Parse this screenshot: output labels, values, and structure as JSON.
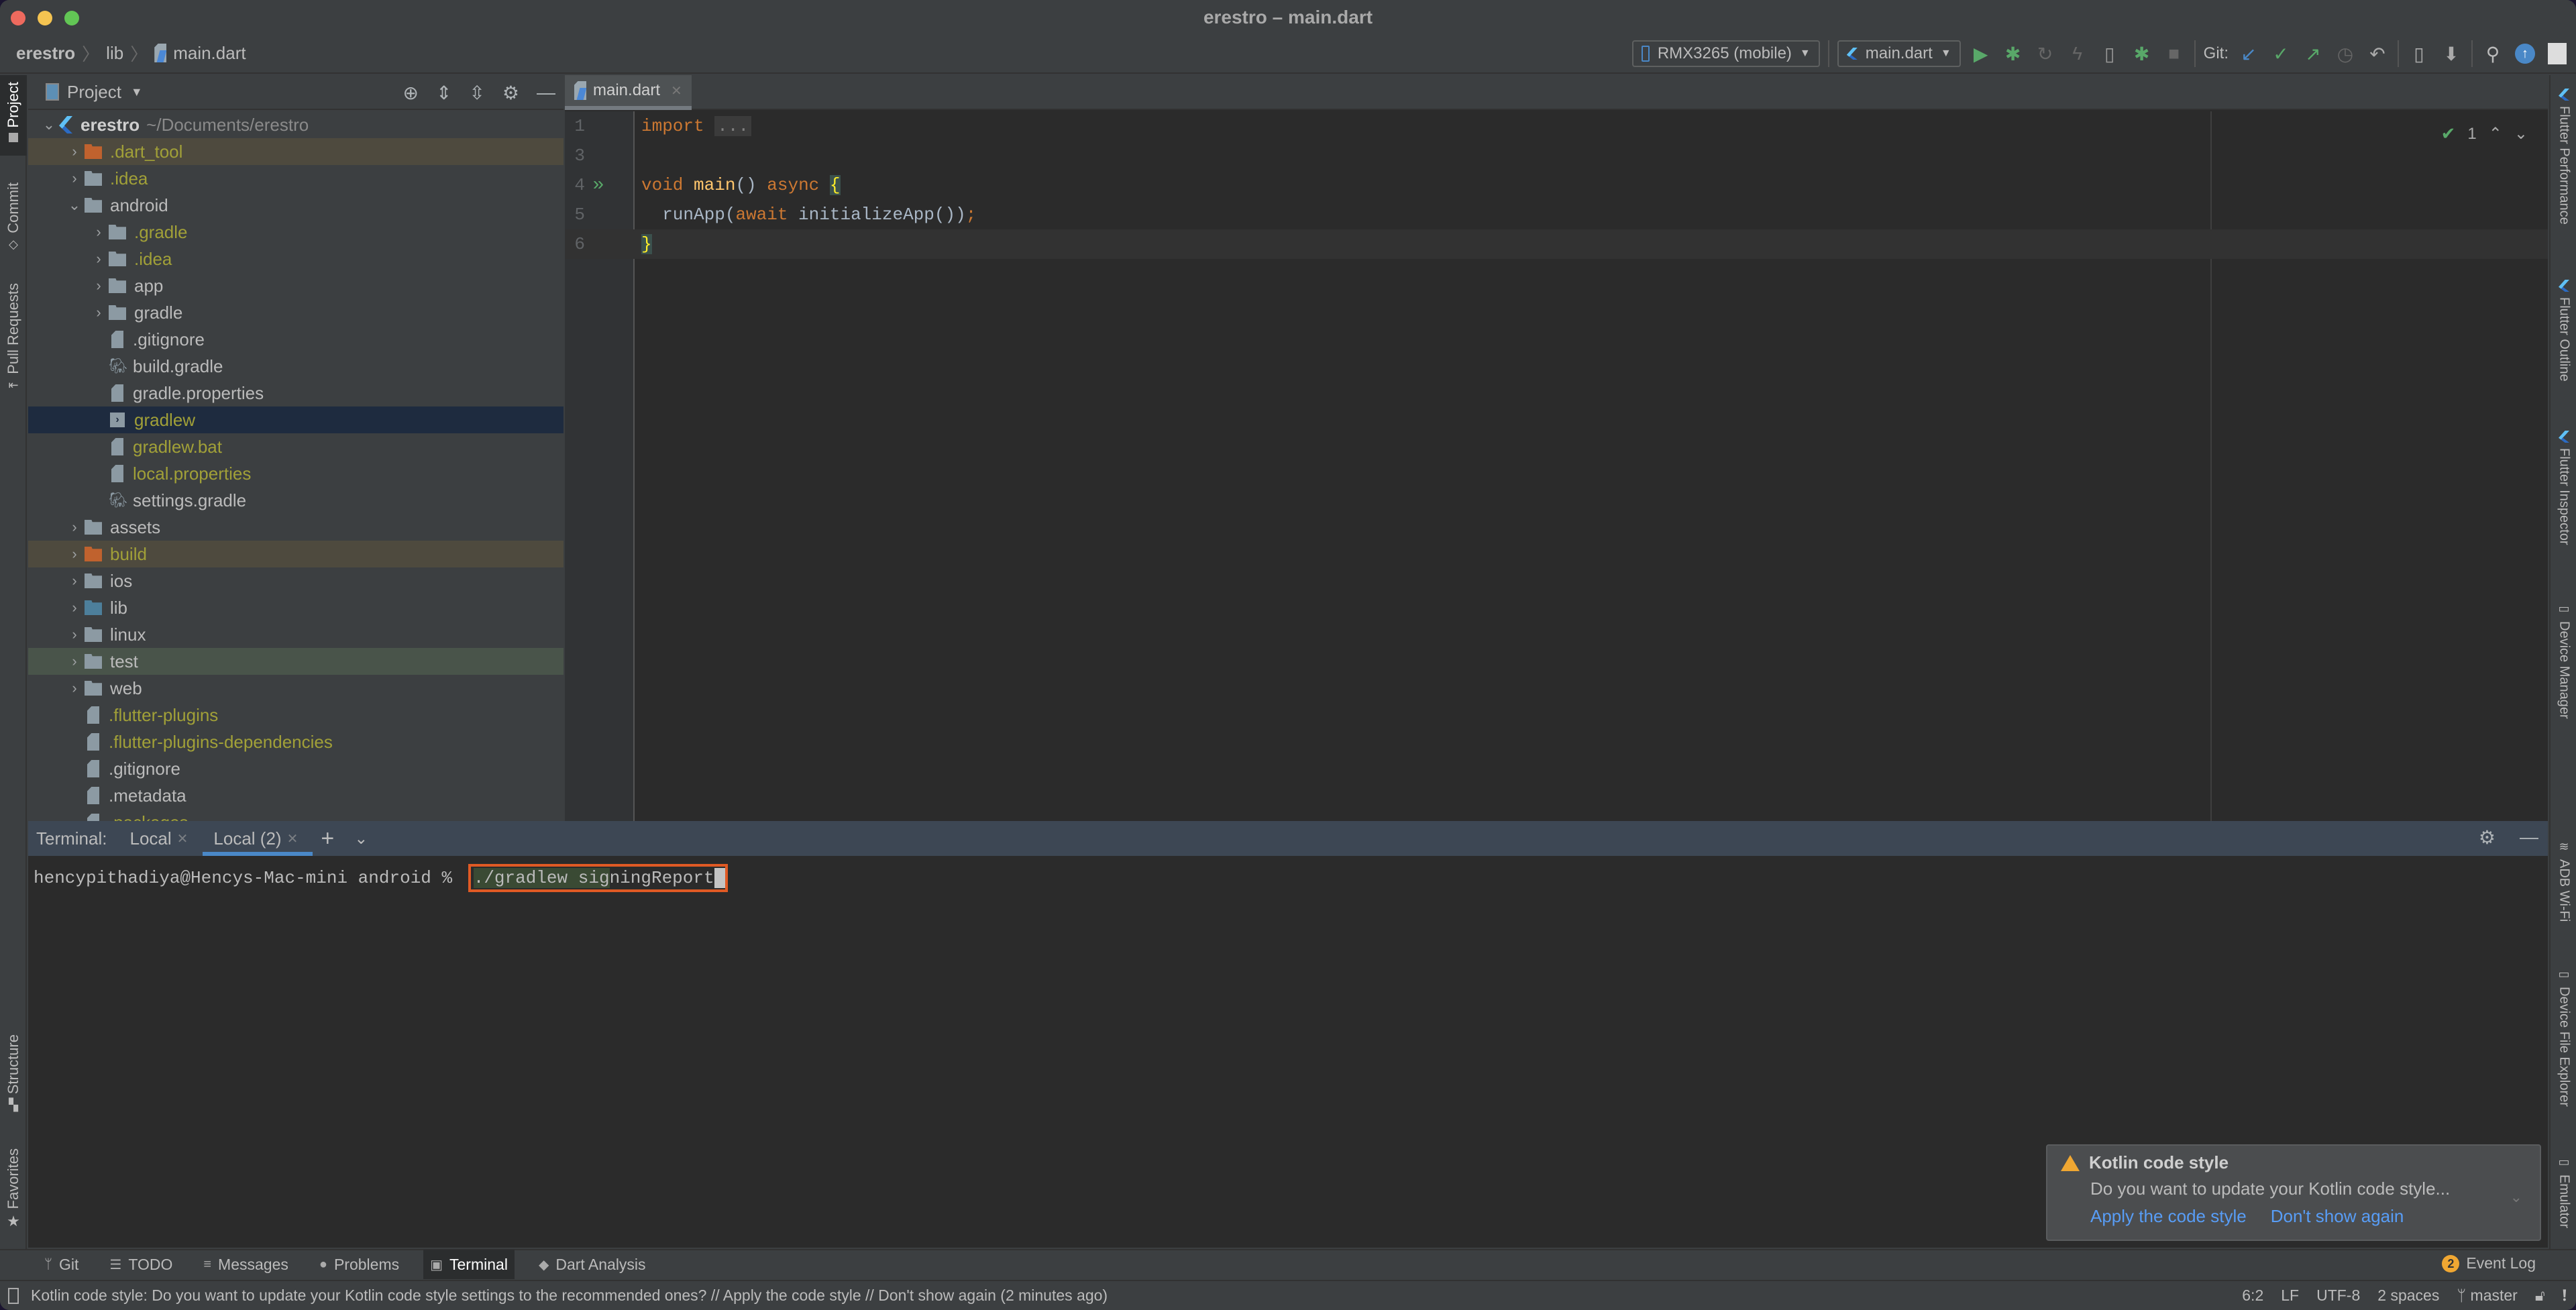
{
  "window": {
    "title": "erestro – main.dart"
  },
  "breadcrumb": [
    "erestro",
    "lib",
    "main.dart"
  ],
  "toolbar": {
    "device": "RMX3265 (mobile)",
    "run_config": "main.dart",
    "git_label": "Git:",
    "icons": [
      "run-icon",
      "debug-icon",
      "attach-icon",
      "hot-reload-icon",
      "flutter-attach-icon",
      "debug-attach-icon",
      "stop-icon",
      "git-update-icon",
      "git-commit-icon",
      "git-push-icon",
      "git-history-icon",
      "git-rollback-icon",
      "avd-manager-icon",
      "sdk-manager-icon",
      "search-icon",
      "upload-icon",
      "avatar-icon"
    ]
  },
  "left_strip": {
    "tabs": [
      "Project",
      "Commit",
      "Pull Requests",
      "Structure",
      "Favorites"
    ]
  },
  "right_strip": {
    "tabs": [
      "Flutter Performance",
      "Flutter Outline",
      "Flutter Inspector",
      "Device Manager",
      "ADB Wi-Fi",
      "Device File Explorer",
      "Emulator"
    ]
  },
  "project": {
    "header": "Project",
    "root": {
      "name": "erestro",
      "path": "~/Documents/erestro"
    },
    "items": [
      {
        "label": ".dart_tool",
        "type": "folder",
        "color": "orange",
        "level": 1,
        "expandable": true,
        "ignored": true,
        "excluded": true
      },
      {
        "label": ".idea",
        "type": "folder",
        "color": "grey",
        "level": 1,
        "expandable": true,
        "ignored": true
      },
      {
        "label": "android",
        "type": "folder",
        "color": "grey",
        "level": 1,
        "expanded": true
      },
      {
        "label": ".gradle",
        "type": "folder",
        "color": "grey",
        "level": 2,
        "expandable": true,
        "ignored": true
      },
      {
        "label": ".idea",
        "type": "folder",
        "color": "grey",
        "level": 2,
        "expandable": true,
        "ignored": true
      },
      {
        "label": "app",
        "type": "folder",
        "color": "grey",
        "level": 2,
        "expandable": true
      },
      {
        "label": "gradle",
        "type": "folder",
        "color": "grey",
        "level": 2,
        "expandable": true
      },
      {
        "label": ".gitignore",
        "type": "file",
        "level": 2
      },
      {
        "label": "build.gradle",
        "type": "gradle",
        "level": 2
      },
      {
        "label": "gradle.properties",
        "type": "file",
        "level": 2
      },
      {
        "label": "gradlew",
        "type": "script",
        "level": 2,
        "ignored": true,
        "selected": true
      },
      {
        "label": "gradlew.bat",
        "type": "file",
        "level": 2,
        "ignored": true
      },
      {
        "label": "local.properties",
        "type": "file",
        "level": 2,
        "ignored": true
      },
      {
        "label": "settings.gradle",
        "type": "gradle",
        "level": 2
      },
      {
        "label": "assets",
        "type": "folder",
        "color": "grey",
        "level": 1,
        "expandable": true
      },
      {
        "label": "build",
        "type": "folder",
        "color": "orange",
        "level": 1,
        "expandable": true,
        "ignored": true,
        "excluded": true
      },
      {
        "label": "ios",
        "type": "folder",
        "color": "grey",
        "level": 1,
        "expandable": true
      },
      {
        "label": "lib",
        "type": "folder",
        "color": "blue",
        "level": 1,
        "expandable": true
      },
      {
        "label": "linux",
        "type": "folder",
        "color": "grey",
        "level": 1,
        "expandable": true
      },
      {
        "label": "test",
        "type": "folder",
        "color": "grey",
        "level": 1,
        "expandable": true,
        "test": true
      },
      {
        "label": "web",
        "type": "folder",
        "color": "grey",
        "level": 1,
        "expandable": true
      },
      {
        "label": ".flutter-plugins",
        "type": "file",
        "level": 1,
        "ignored": true,
        "noChevron": true
      },
      {
        "label": ".flutter-plugins-dependencies",
        "type": "file",
        "level": 1,
        "ignored": true,
        "noChevron": true
      },
      {
        "label": ".gitignore",
        "type": "file",
        "level": 1,
        "noChevron": true
      },
      {
        "label": ".metadata",
        "type": "file",
        "level": 1,
        "noChevron": true
      },
      {
        "label": ".packages",
        "type": "file",
        "level": 1,
        "ignored": true,
        "noChevron": true
      }
    ]
  },
  "editor": {
    "tab": "main.dart",
    "inspection_count": "1",
    "lines": [
      {
        "num": "1",
        "tokens": [
          [
            "kw",
            "import"
          ],
          [
            "plain",
            " "
          ],
          [
            "fold",
            "..."
          ]
        ]
      },
      {
        "num": "3",
        "tokens": []
      },
      {
        "num": "4",
        "run": true,
        "tokens": [
          [
            "kw",
            "void"
          ],
          [
            "plain",
            " "
          ],
          [
            "fn",
            "main"
          ],
          [
            "plain",
            "() "
          ],
          [
            "kw",
            "async"
          ],
          [
            "plain",
            " "
          ],
          [
            "brace",
            "{"
          ]
        ]
      },
      {
        "num": "5",
        "tokens": [
          [
            "plain",
            "  runApp("
          ],
          [
            "kw",
            "await"
          ],
          [
            "plain",
            " initializeApp())"
          ],
          [
            "kw",
            ";"
          ]
        ]
      },
      {
        "num": "6",
        "current": true,
        "tokens": [
          [
            "brace",
            "}"
          ]
        ]
      }
    ]
  },
  "terminal": {
    "label": "Terminal:",
    "tabs": [
      {
        "label": "Local",
        "active": false
      },
      {
        "label": "Local (2)",
        "active": true
      }
    ],
    "prompt": "hencypithadiya@Hencys-Mac-mini android % ",
    "command_highlighted": "./gradlew sig",
    "command_rest": "ningReport"
  },
  "notification": {
    "title": "Kotlin code style",
    "body": "Do you want to update your Kotlin code style...",
    "actions": [
      "Apply the code style",
      "Don't show again"
    ]
  },
  "bottom_tools": {
    "tabs": [
      {
        "label": "Git",
        "icon": "git-branch-icon"
      },
      {
        "label": "TODO",
        "icon": "todo-list-icon"
      },
      {
        "label": "Messages",
        "icon": "messages-icon"
      },
      {
        "label": "Problems",
        "icon": "problems-icon"
      },
      {
        "label": "Terminal",
        "icon": "terminal-icon",
        "active": true
      },
      {
        "label": "Dart Analysis",
        "icon": "dart-analysis-icon"
      }
    ],
    "event_log": {
      "label": "Event Log",
      "count": "2"
    }
  },
  "status": {
    "message": "Kotlin code style: Do you want to update your Kotlin code style settings to the recommended ones? // Apply the code style // Don't show again (2 minutes ago)",
    "position": "6:2",
    "line_ending": "LF",
    "encoding": "UTF-8",
    "indent": "2 spaces",
    "branch": "master"
  }
}
